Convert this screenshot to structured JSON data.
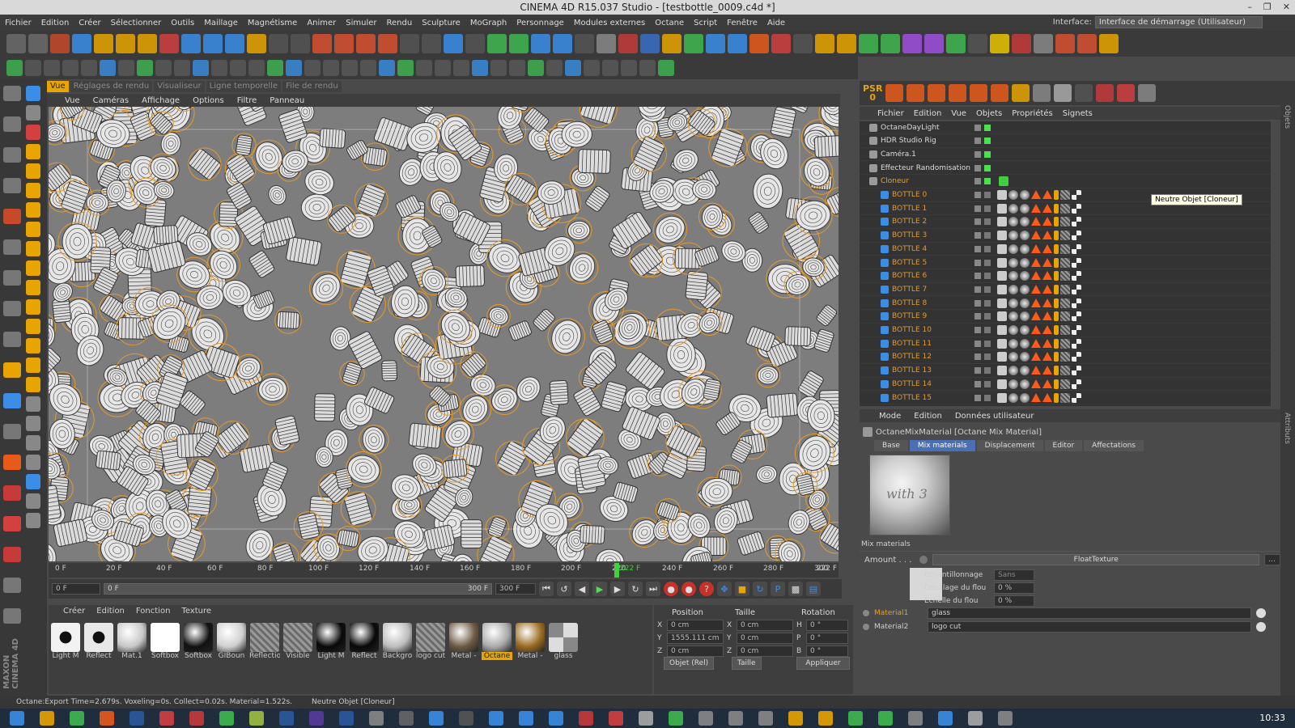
{
  "window": {
    "title": "CINEMA 4D R15.037 Studio - [testbottle_0009.c4d *]"
  },
  "menu": [
    "Fichier",
    "Edition",
    "Créer",
    "Sélectionner",
    "Outils",
    "Maillage",
    "Magnétisme",
    "Animer",
    "Simuler",
    "Rendu",
    "Sculpture",
    "MoGraph",
    "Personnage",
    "Modules externes",
    "Octane",
    "Script",
    "Fenêtre",
    "Aide"
  ],
  "interface": {
    "label": "Interface:",
    "value": "Interface de démarrage (Utilisateur)"
  },
  "viewport_tabs": [
    "Vue",
    "Réglages de rendu",
    "Visualiseur",
    "Ligne temporelle",
    "File de rendu"
  ],
  "viewport_menu": [
    "Vue",
    "Caméras",
    "Affichage",
    "Options",
    "Filtre",
    "Panneau"
  ],
  "timeline": {
    "ticks": [
      "0 F",
      "20 F",
      "40 F",
      "60 F",
      "80 F",
      "100 F",
      "120 F",
      "140 F",
      "160 F",
      "180 F",
      "200 F",
      "220",
      "240 F",
      "260 F",
      "280 F",
      "300"
    ],
    "current": "222 F",
    "end_display": "222 F",
    "current_frame": 222,
    "max_frame": 300
  },
  "transport": {
    "start_field": "0 F",
    "range_start": "0 F",
    "range_end": "300 F",
    "end_field": "300 F"
  },
  "materials": {
    "menu": [
      "Créer",
      "Edition",
      "Fonction",
      "Texture"
    ],
    "items": [
      {
        "name": "Light M",
        "color": "#f2f2f2",
        "style": "dark-stripe"
      },
      {
        "name": "Reflect",
        "color": "#e8e8e8",
        "style": "dark-stripe"
      },
      {
        "name": "Mat.1",
        "color": "#c8c8c8",
        "style": "sphere"
      },
      {
        "name": "Softbox",
        "color": "#ffffff",
        "style": "flat"
      },
      {
        "name": "Softbox",
        "color": "#111111",
        "style": "sphere"
      },
      {
        "name": "GIBoun",
        "color": "#d0d0d0",
        "style": "sphere"
      },
      {
        "name": "Reflectio",
        "color": "#888888",
        "style": "hatch"
      },
      {
        "name": "Visible",
        "color": "#888888",
        "style": "hatch"
      },
      {
        "name": "Light M",
        "color": "#080808",
        "style": "sphere"
      },
      {
        "name": "Reflect",
        "color": "#080808",
        "style": "sphere"
      },
      {
        "name": "Backgro",
        "color": "#bdbdbd",
        "style": "sphere"
      },
      {
        "name": "logo cut",
        "color": "#777777",
        "style": "hatch"
      },
      {
        "name": "Metal -",
        "color": "#6e5a44",
        "style": "sphere"
      },
      {
        "name": "Octane",
        "color": "#aaaaaa",
        "style": "sphere"
      },
      {
        "name": "Metal -",
        "color": "#9a6a20",
        "style": "sphere"
      },
      {
        "name": "glass",
        "color": "#aaaaaa",
        "style": "checker"
      }
    ]
  },
  "coords": {
    "headers": [
      "Position",
      "Taille",
      "Rotation"
    ],
    "rows": [
      {
        "axis": "X",
        "pos": "0 cm",
        "size_axis": "X",
        "size": "0 cm",
        "rot_axis": "H",
        "rot": "0 °"
      },
      {
        "axis": "Y",
        "pos": "1555.111 cm",
        "size_axis": "Y",
        "size": "0 cm",
        "rot_axis": "P",
        "rot": "0 °"
      },
      {
        "axis": "Z",
        "pos": "0 cm",
        "size_axis": "Z",
        "size": "0 cm",
        "rot_axis": "B",
        "rot": "0 °"
      }
    ],
    "mode": "Objet (Rel)",
    "size_mode": "Taille",
    "apply": "Appliquer"
  },
  "status": {
    "left": "Octane:Export Time=2.679s. Voxeling=0s. Collect=0.02s. Material=1.522s.",
    "right": "Neutre Objet [Cloneur]"
  },
  "objects": {
    "menu": [
      "Fichier",
      "Edition",
      "Vue",
      "Objets",
      "Propriétés",
      "Signets"
    ],
    "psr_label": "PSR",
    "psr_value": "0",
    "rows": [
      {
        "name": "OctaneDayLight",
        "indent": 0
      },
      {
        "name": "HDR Studio Rig",
        "indent": 0
      },
      {
        "name": "Caméra.1",
        "indent": 0
      },
      {
        "name": "Effecteur Randomisation",
        "indent": 0
      },
      {
        "name": "Cloneur",
        "indent": 0,
        "selected": true
      },
      {
        "name": "BOTTLE 0",
        "indent": 1
      },
      {
        "name": "BOTTLE 1",
        "indent": 1
      },
      {
        "name": "BOTTLE 2",
        "indent": 1
      },
      {
        "name": "BOTTLE 3",
        "indent": 1
      },
      {
        "name": "BOTTLE 4",
        "indent": 1
      },
      {
        "name": "BOTTLE 5",
        "indent": 1
      },
      {
        "name": "BOTTLE 6",
        "indent": 1
      },
      {
        "name": "BOTTLE 7",
        "indent": 1
      },
      {
        "name": "BOTTLE 8",
        "indent": 1
      },
      {
        "name": "BOTTLE 9",
        "indent": 1
      },
      {
        "name": "BOTTLE 10",
        "indent": 1
      },
      {
        "name": "BOTTLE 11",
        "indent": 1
      },
      {
        "name": "BOTTLE 12",
        "indent": 1
      },
      {
        "name": "BOTTLE 13",
        "indent": 1
      },
      {
        "name": "BOTTLE 14",
        "indent": 1
      },
      {
        "name": "BOTTLE 15",
        "indent": 1
      }
    ],
    "tooltip": "Neutre Objet [Cloneur]"
  },
  "attributes": {
    "menu": [
      "Mode",
      "Edition",
      "Données utilisateur"
    ],
    "title": "OctaneMixMaterial [Octane Mix Material]",
    "tabs": [
      "Base",
      "Mix materials",
      "Displacement",
      "Editor",
      "Affectations"
    ],
    "active_tab": "Mix materials",
    "section": "Mix materials",
    "amount_label": "Amount . . .",
    "amount_value": "FloatTexture",
    "sampling_label": "Echantillonnage",
    "sampling_value": "Sans",
    "blur_offset_label": "Décalage du flou",
    "blur_offset_value": "0 %",
    "blur_scale_label": "Echelle du flou",
    "blur_scale_value": "0 %",
    "mat1_label": "Material1",
    "mat1_value": "glass",
    "mat2_label": "Material2",
    "mat2_value": "logo cut",
    "preview_text": "with 3"
  },
  "side_labels": [
    "Objets",
    "Attributs"
  ],
  "clock": "10:33",
  "colors": {
    "accent": "#e8a400",
    "tab_active": "#4a6fb5",
    "bottle_child": "#e59a2b"
  }
}
